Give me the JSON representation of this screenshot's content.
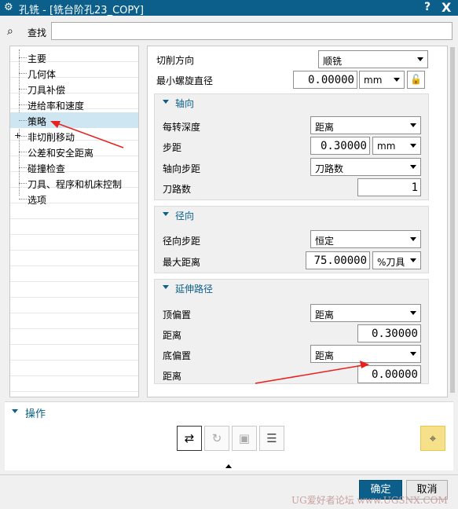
{
  "window": {
    "title": "孔铣 - [铣台阶孔23_COPY]",
    "help_label": "?",
    "close_label": "X"
  },
  "find": {
    "label": "查找",
    "value": ""
  },
  "tree": {
    "items": [
      {
        "label": "主要"
      },
      {
        "label": "几何体"
      },
      {
        "label": "刀具补偿"
      },
      {
        "label": "进给率和速度"
      },
      {
        "label": "策略"
      },
      {
        "label": "非切削移动",
        "expander": "+"
      },
      {
        "label": "公差和安全距离"
      },
      {
        "label": "碰撞检查"
      },
      {
        "label": "刀具、程序和机床控制"
      },
      {
        "label": "选项"
      }
    ],
    "selected_index": 4
  },
  "main": {
    "cut_direction": {
      "label": "切削方向",
      "value": "顺铣"
    },
    "min_helix_diameter": {
      "label": "最小螺旋直径",
      "value": "0.00000",
      "unit": "mm"
    },
    "axial": {
      "title": "轴向",
      "depth_per_rev": {
        "label": "每转深度",
        "value": "距离"
      },
      "step": {
        "label": "步距",
        "value": "0.30000",
        "unit": "mm"
      },
      "axial_step": {
        "label": "轴向步距",
        "value": "刀路数"
      },
      "num_paths": {
        "label": "刀路数",
        "value": "1"
      }
    },
    "radial": {
      "title": "径向",
      "radial_step": {
        "label": "径向步距",
        "value": "恒定"
      },
      "max_distance": {
        "label": "最大距离",
        "value": "75.00000",
        "unit": "%刀具"
      }
    },
    "extend": {
      "title": "延伸路径",
      "top_offset": {
        "label": "顶偏置",
        "value": "距离"
      },
      "top_distance": {
        "label": "距离",
        "value": "0.30000"
      },
      "bottom_offset": {
        "label": "底偏置",
        "value": "距离"
      },
      "bottom_distance": {
        "label": "距离",
        "value": "0.00000"
      }
    }
  },
  "actions": {
    "title": "操作",
    "tools": [
      {
        "icon": "generate-icon"
      },
      {
        "icon": "replay-icon"
      },
      {
        "icon": "verify-icon"
      },
      {
        "icon": "list-icon"
      },
      {
        "icon": "display-tool-icon"
      }
    ]
  },
  "buttons": {
    "ok": "确定",
    "cancel": "取消"
  },
  "watermark": "UG爱好者论坛 www.UGSNX.COM",
  "colors": {
    "accent": "#0b5f8a",
    "selection": "#cde6f2",
    "annotation_arrow": "#e8201e"
  }
}
